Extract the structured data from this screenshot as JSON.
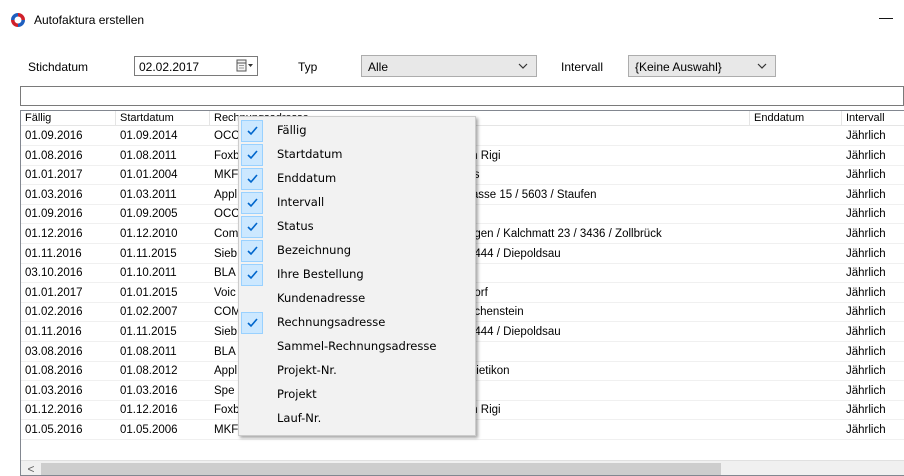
{
  "window": {
    "title": "Autofaktura erstellen",
    "minimize_glyph": "—"
  },
  "filters": {
    "stichdatum_label": "Stichdatum",
    "stichdatum_value": "02.02.2017",
    "typ_label": "Typ",
    "typ_value": "Alle",
    "intervall_label": "Intervall",
    "intervall_value": "{Keine Auswahl}"
  },
  "table": {
    "columns": [
      "Fällig",
      "Startdatum",
      "Rechnungsadresse",
      "Enddatum",
      "Intervall"
    ],
    "rows": [
      [
        "01.09.2016",
        "01.09.2014",
        "OCC",
        "",
        "Jährlich"
      ],
      [
        "01.08.2016",
        "01.08.2011",
        "Foxb",
        "m Rigi",
        "Jährlich"
      ],
      [
        "01.01.2017",
        "01.01.2004",
        "MKF",
        "ss",
        "Jährlich"
      ],
      [
        "01.03.2016",
        "01.03.2011",
        "Appl",
        "rasse 15 / 5603 / Staufen",
        "Jährlich"
      ],
      [
        "01.09.2016",
        "01.09.2005",
        "OCC",
        "",
        "Jährlich"
      ],
      [
        "01.12.2016",
        "01.12.2010",
        "Com",
        "ngen / Kalchmatt 23 / 3436 / Zollbrück",
        "Jährlich"
      ],
      [
        "01.11.2016",
        "01.11.2015",
        "Sieb",
        "9444 / Diepoldsau",
        "Jährlich"
      ],
      [
        "03.10.2016",
        "01.10.2011",
        "BLA",
        "",
        "Jährlich"
      ],
      [
        "01.01.2017",
        "01.01.2015",
        "Voic",
        "dorf",
        "Jährlich"
      ],
      [
        "01.02.2016",
        "01.02.2007",
        "COM",
        "nchenstein",
        "Jährlich"
      ],
      [
        "01.11.2016",
        "01.11.2015",
        "Sieb",
        "9444 / Diepoldsau",
        "Jährlich"
      ],
      [
        "03.08.2016",
        "01.08.2011",
        "BLA",
        "",
        "Jährlich"
      ],
      [
        "01.08.2016",
        "01.08.2012",
        "Appl",
        "Dietikon",
        "Jährlich"
      ],
      [
        "01.03.2016",
        "01.03.2016",
        "Spe",
        "",
        "Jährlich"
      ],
      [
        "01.12.2016",
        "01.12.2016",
        "Foxb",
        "m Rigi",
        "Jährlich"
      ],
      [
        "01.05.2016",
        "01.05.2006",
        "MKF Informatik AG /  / Werkstrasse 16 / 3250 / Lyss",
        "",
        "Jährlich"
      ]
    ]
  },
  "scrollbar": {
    "left_arrow": "<"
  },
  "column_menu": {
    "items": [
      {
        "label": "Fällig",
        "checked": true
      },
      {
        "label": "Startdatum",
        "checked": true
      },
      {
        "label": "Enddatum",
        "checked": true
      },
      {
        "label": "Intervall",
        "checked": true
      },
      {
        "label": "Status",
        "checked": true
      },
      {
        "label": "Bezeichnung",
        "checked": true
      },
      {
        "label": "Ihre Bestellung",
        "checked": true
      },
      {
        "label": "Kundenadresse",
        "checked": false
      },
      {
        "label": "Rechnungsadresse",
        "checked": true
      },
      {
        "label": "Sammel-Rechnungsadresse",
        "checked": false
      },
      {
        "label": "Projekt-Nr.",
        "checked": false
      },
      {
        "label": "Projekt",
        "checked": false
      },
      {
        "label": "Lauf-Nr.",
        "checked": false
      }
    ]
  },
  "colors": {
    "accent": "#cce8ff",
    "check": "#0066cc",
    "icon_red": "#d0202a",
    "icon_blue": "#1f5fbf"
  }
}
